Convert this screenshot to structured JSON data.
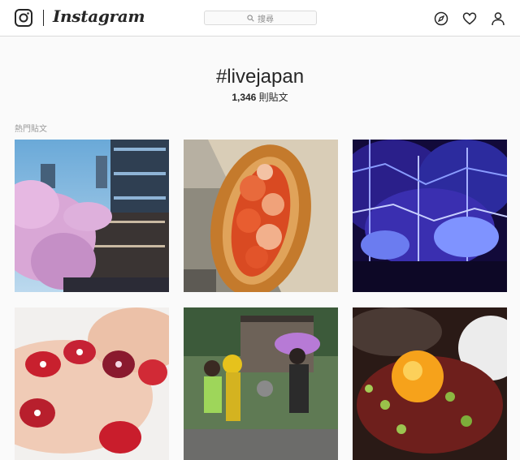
{
  "header": {
    "brand": "Instagram",
    "search_placeholder": "搜尋",
    "icons": [
      "instagram-camera-icon",
      "explore-compass-icon",
      "activity-heart-icon",
      "profile-person-icon"
    ]
  },
  "tag": {
    "name": "#livejapan",
    "post_count": "1,346",
    "post_unit": " 則貼文"
  },
  "section": {
    "label": "熱門貼文"
  },
  "posts": [
    {
      "subject": "cherry-blossom-riverside"
    },
    {
      "subject": "lobster-roll"
    },
    {
      "subject": "blue-illumination-trees"
    },
    {
      "subject": "nail-art-flowers"
    },
    {
      "subject": "people-with-statue-umbrella"
    },
    {
      "subject": "egg-yolk-dish"
    }
  ],
  "colors": {
    "text": "#262626",
    "muted": "#999999",
    "border": "#dbdbdb",
    "background": "#fafafa"
  }
}
